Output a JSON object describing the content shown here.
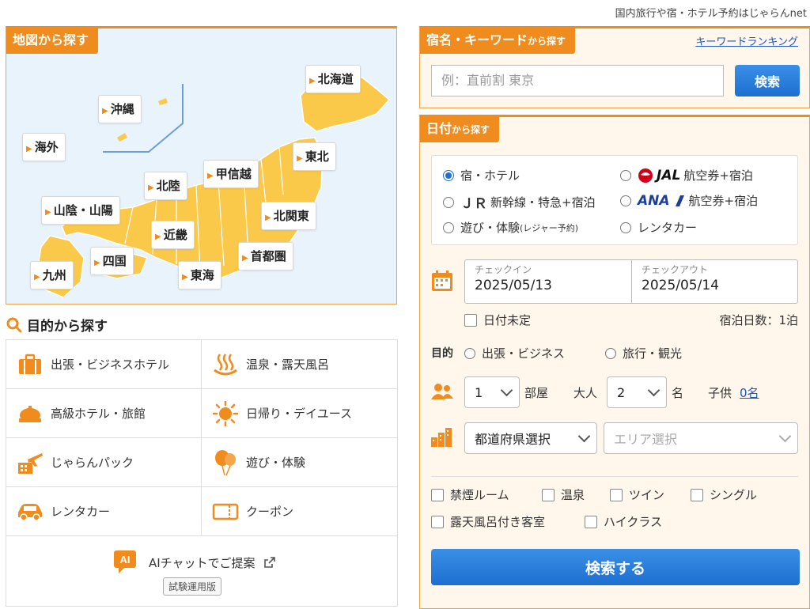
{
  "tagline": "国内旅行や宿・ホテル予約はじゃらんnet",
  "map": {
    "title": "地図から探す",
    "regions": [
      {
        "name": "北海道"
      },
      {
        "name": "沖縄"
      },
      {
        "name": "海外"
      },
      {
        "name": "東北"
      },
      {
        "name": "甲信越"
      },
      {
        "name": "北陸"
      },
      {
        "name": "山陰・山陽"
      },
      {
        "name": "北関東"
      },
      {
        "name": "近畿"
      },
      {
        "name": "四国"
      },
      {
        "name": "首都圏"
      },
      {
        "name": "九州"
      },
      {
        "name": "東海"
      }
    ]
  },
  "purpose": {
    "title": "目的から探す",
    "items": [
      {
        "label": "出張・ビジネスホテル",
        "icon": "briefcase-icon"
      },
      {
        "label": "温泉・露天風呂",
        "icon": "hot-spring-icon"
      },
      {
        "label": "高級ホテル・旅館",
        "icon": "crown-icon"
      },
      {
        "label": "日帰り・デイユース",
        "icon": "sun-icon"
      },
      {
        "label": "じゃらんパック",
        "icon": "plane-hotel-icon"
      },
      {
        "label": "遊び・体験",
        "icon": "balloon-icon"
      },
      {
        "label": "レンタカー",
        "icon": "car-icon"
      },
      {
        "label": "クーポン",
        "icon": "coupon-icon"
      }
    ],
    "ai_chat": "AIチャットでご提案",
    "ai_badge": "AI",
    "trial": "試験運用版"
  },
  "keyword": {
    "title": "宿名・キーワード",
    "title_suffix": "から探す",
    "ranking": "キーワードランキング",
    "placeholder": "例：直前割 東京",
    "button": "検索"
  },
  "date": {
    "title": "日付",
    "title_suffix": "から探す",
    "types": {
      "hotel": "宿・ホテル",
      "jal_logo": "JAL",
      "jal": "航空券+宿泊",
      "jr_logo": "ＪＲ",
      "jr": "新幹線・特急+宿泊",
      "ana_logo": "ANA",
      "ana": "航空券+宿泊",
      "leisure": "遊び・体験",
      "leisure_note": "(レジャー予約)",
      "rentacar": "レンタカー"
    },
    "checkin_label": "チェックイン",
    "checkin": "2025/05/13",
    "checkout_label": "チェックアウト",
    "checkout": "2025/05/14",
    "undecided": "日付未定",
    "nights": "宿泊日数：1泊",
    "purpose_label": "目的",
    "purpose_business": "出張・ビジネス",
    "purpose_travel": "旅行・観光",
    "rooms": "1",
    "rooms_unit": "部屋",
    "adults_label": "大人",
    "adults": "2",
    "adults_unit": "名",
    "children_label": "子供",
    "children": "0名",
    "prefecture": "都道府県選択",
    "area": "エリア選択",
    "options": [
      "禁煙ルーム",
      "温泉",
      "ツイン",
      "シングル",
      "露天風呂付き客室",
      "ハイクラス"
    ],
    "search": "検索する"
  },
  "colors": {
    "accent": "#f08c1e",
    "button": "#1d6fd0",
    "map_land": "#fbc94a",
    "map_sea": "#e8f3fb"
  }
}
